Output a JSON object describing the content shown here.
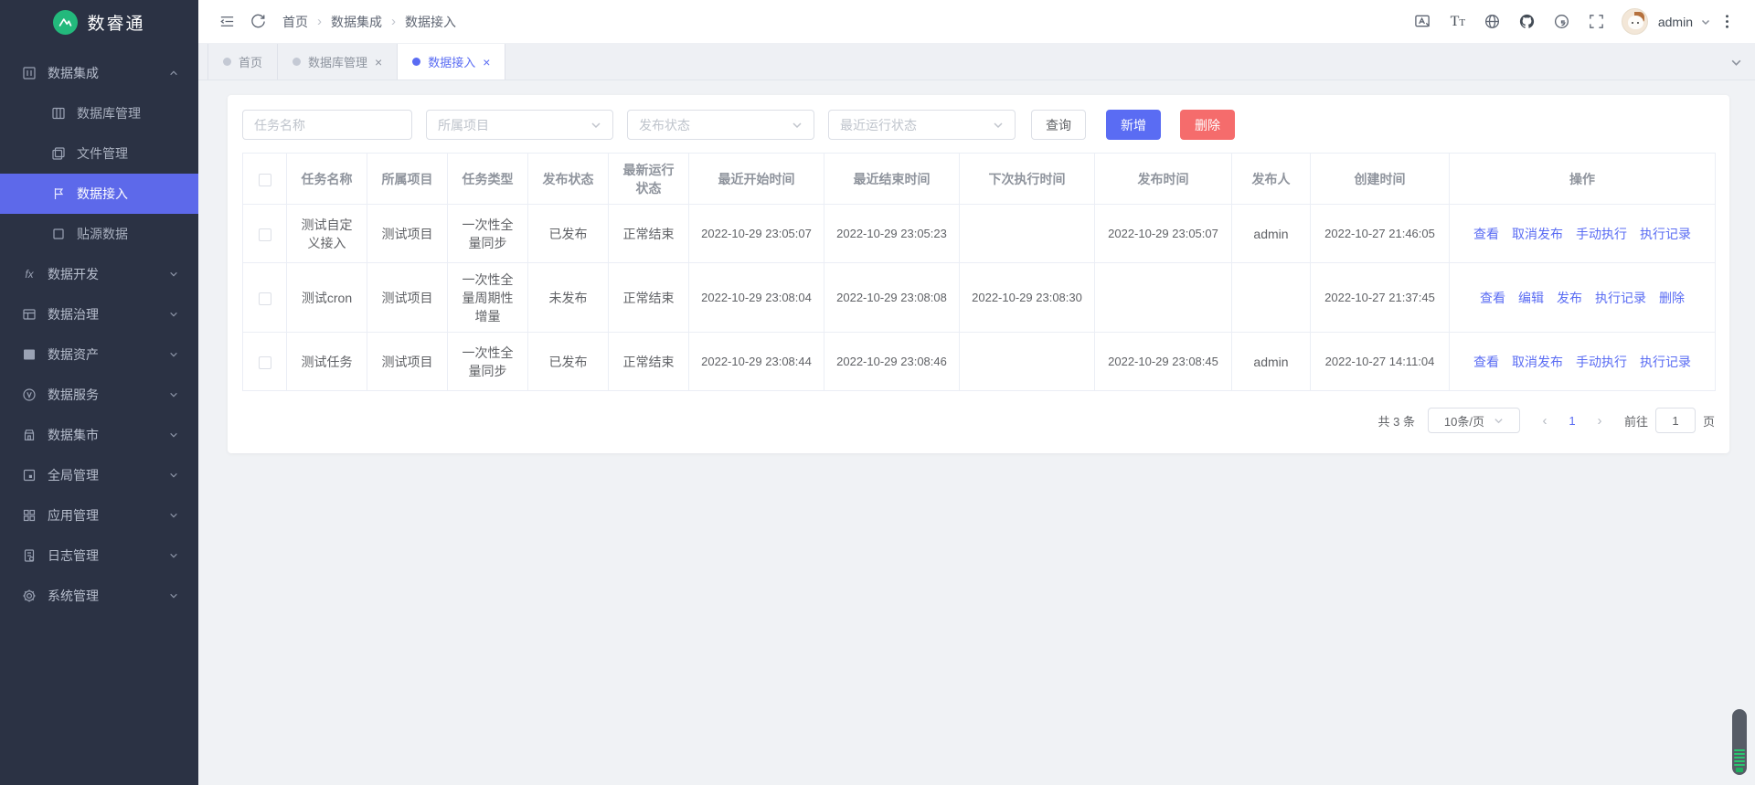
{
  "sidebar": {
    "logo_text": "数睿通",
    "items": [
      {
        "label": "数据集成"
      },
      {
        "label": "数据库管理"
      },
      {
        "label": "文件管理"
      },
      {
        "label": "数据接入"
      },
      {
        "label": "贴源数据"
      },
      {
        "label": "数据开发"
      },
      {
        "label": "数据治理"
      },
      {
        "label": "数据资产"
      },
      {
        "label": "数据服务"
      },
      {
        "label": "数据集市"
      },
      {
        "label": "全局管理"
      },
      {
        "label": "应用管理"
      },
      {
        "label": "日志管理"
      },
      {
        "label": "系统管理"
      }
    ]
  },
  "header": {
    "breadcrumb": [
      "首页",
      "数据集成",
      "数据接入"
    ],
    "user": "admin"
  },
  "tabs": [
    {
      "label": "首页"
    },
    {
      "label": "数据库管理"
    },
    {
      "label": "数据接入"
    }
  ],
  "glyphs": {
    "close": "×",
    "crumb_sep": "›",
    "prev": "‹",
    "next": "›"
  },
  "filters": {
    "task_name_placeholder": "任务名称",
    "project_placeholder": "所属项目",
    "publish_status_placeholder": "发布状态",
    "run_status_placeholder": "最近运行状态",
    "search_label": "查询",
    "add_label": "新增",
    "delete_label": "删除"
  },
  "table": {
    "columns": [
      "任务名称",
      "所属项目",
      "任务类型",
      "发布状态",
      "最新运行状态",
      "最近开始时间",
      "最近结束时间",
      "下次执行时间",
      "发布时间",
      "发布人",
      "创建时间",
      "操作"
    ],
    "rows": [
      {
        "task_name": "测试自定义接入",
        "project": "测试项目",
        "task_type": "一次性全量同步",
        "publish_status": "已发布",
        "run_status": "正常结束",
        "start_time": "2022-10-29 23:05:07",
        "end_time": "2022-10-29 23:05:23",
        "next_time": "",
        "publish_time": "2022-10-29 23:05:07",
        "publisher": "admin",
        "create_time": "2022-10-27 21:46:05",
        "actions": [
          "查看",
          "取消发布",
          "手动执行",
          "执行记录"
        ]
      },
      {
        "task_name": "测试cron",
        "project": "测试项目",
        "task_type": "一次性全量周期性增量",
        "publish_status": "未发布",
        "run_status": "正常结束",
        "start_time": "2022-10-29 23:08:04",
        "end_time": "2022-10-29 23:08:08",
        "next_time": "2022-10-29 23:08:30",
        "publish_time": "",
        "publisher": "",
        "create_time": "2022-10-27 21:37:45",
        "actions": [
          "查看",
          "编辑",
          "发布",
          "执行记录",
          "删除"
        ]
      },
      {
        "task_name": "测试任务",
        "project": "测试项目",
        "task_type": "一次性全量同步",
        "publish_status": "已发布",
        "run_status": "正常结束",
        "start_time": "2022-10-29 23:08:44",
        "end_time": "2022-10-29 23:08:46",
        "next_time": "",
        "publish_time": "2022-10-29 23:08:45",
        "publisher": "admin",
        "create_time": "2022-10-27 14:11:04",
        "actions": [
          "查看",
          "取消发布",
          "手动执行",
          "执行记录"
        ]
      }
    ]
  },
  "pagination": {
    "total_text": "共 3 条",
    "page_size": "10条/页",
    "current_page": "1",
    "goto_label": "前往",
    "goto_value": "1",
    "page_unit": "页"
  },
  "colors": {
    "accent": "#5a6cf3",
    "danger": "#f56c6c",
    "sidebar_bg": "#2b3244",
    "active_item_bg": "#5d69ea"
  }
}
